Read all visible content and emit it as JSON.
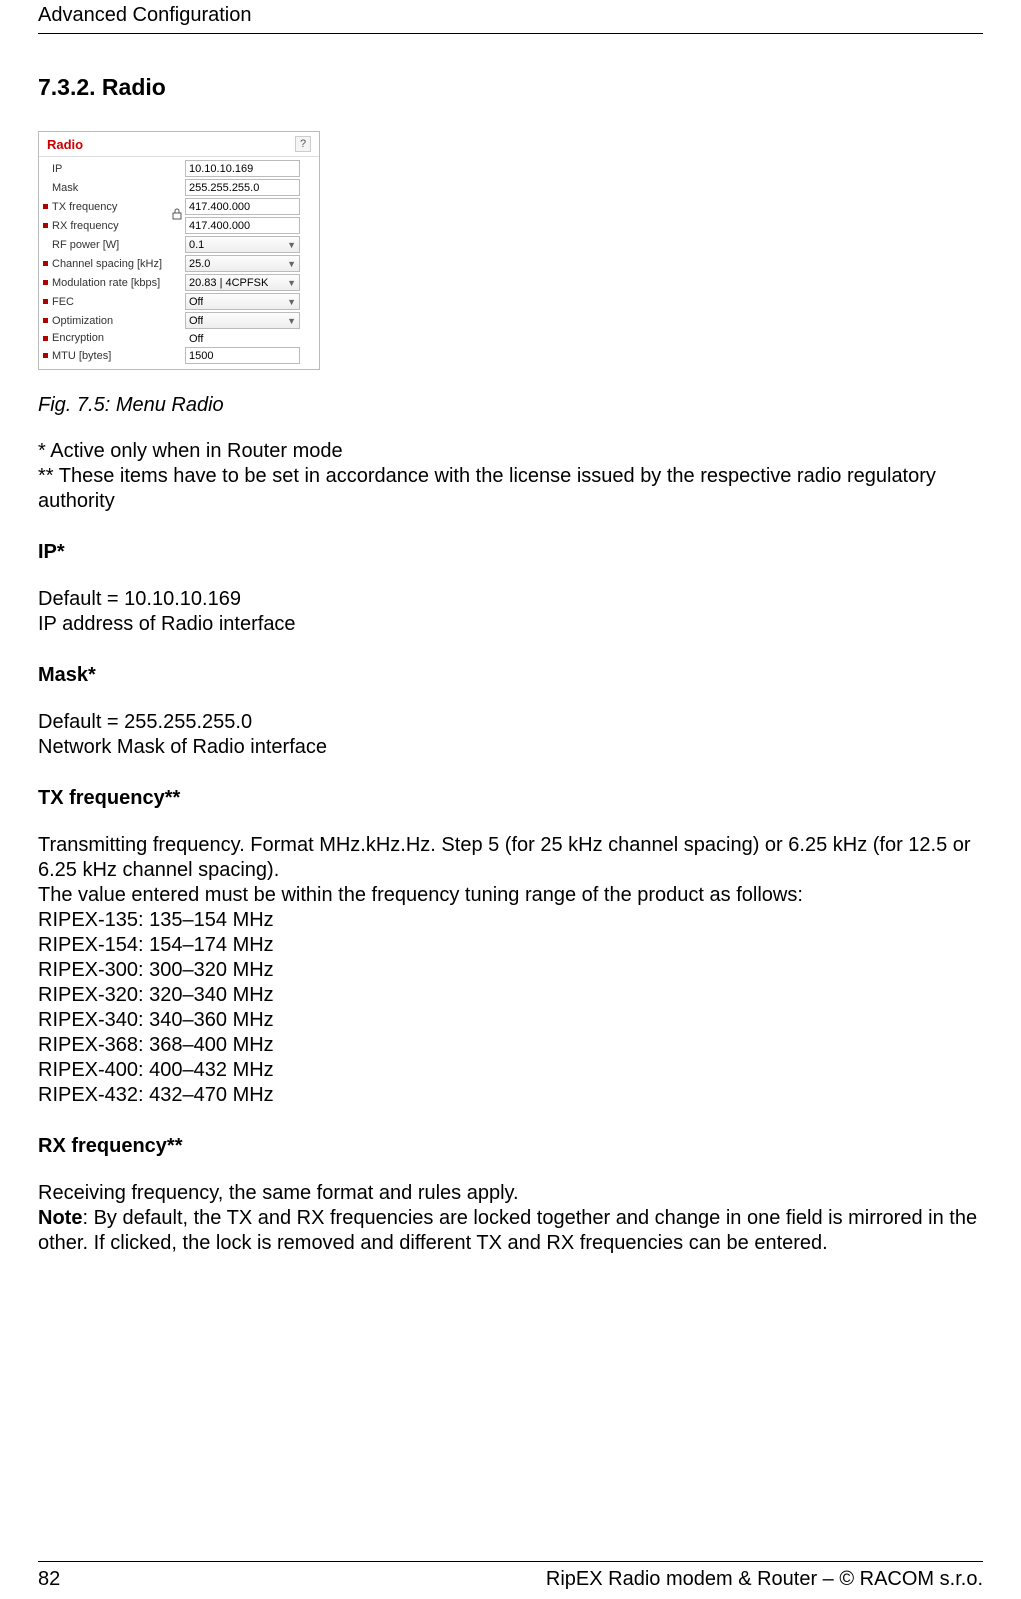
{
  "header": {
    "running": "Advanced Configuration"
  },
  "heading": "7.3.2. Radio",
  "panel": {
    "title": "Radio",
    "help": "?",
    "rows": [
      {
        "bullet": false,
        "label": "IP",
        "type": "text",
        "value": "10.10.10.169"
      },
      {
        "bullet": false,
        "label": "Mask",
        "type": "text",
        "value": "255.255.255.0"
      },
      {
        "bullet": true,
        "label": "TX frequency",
        "type": "text",
        "value": "417.400.000",
        "lock": true
      },
      {
        "bullet": true,
        "label": "RX frequency",
        "type": "text",
        "value": "417.400.000"
      },
      {
        "bullet": false,
        "label": "RF power [W]",
        "type": "select",
        "value": "0.1"
      },
      {
        "bullet": true,
        "label": "Channel spacing [kHz]",
        "type": "select",
        "value": "25.0"
      },
      {
        "bullet": true,
        "label": "Modulation rate [kbps]",
        "type": "select",
        "value": "20.83 | 4CPFSK"
      },
      {
        "bullet": true,
        "label": "FEC",
        "type": "select",
        "value": "Off"
      },
      {
        "bullet": true,
        "label": "Optimization",
        "type": "select",
        "value": "Off"
      },
      {
        "bullet": true,
        "label": "Encryption",
        "type": "text-ro",
        "value": "Off"
      },
      {
        "bullet": true,
        "label": "MTU [bytes]",
        "type": "text",
        "value": "1500"
      }
    ]
  },
  "caption": "Fig. 7.5: Menu Radio",
  "notes": {
    "star1": "* Active only when in Router mode",
    "star2": "** These items have to be set in accordance with the license issued by the respective radio regulatory authority"
  },
  "sections": {
    "ip": {
      "title": "IP*",
      "l1": "Default = 10.10.10.169",
      "l2": "IP address of Radio interface"
    },
    "mask": {
      "title": "Mask*",
      "l1": "Default = 255.255.255.0",
      "l2": "Network Mask of Radio interface"
    },
    "txf": {
      "title": "TX frequency**",
      "p1": "Transmitting frequency. Format MHz.kHz.Hz. Step 5 (for 25 kHz channel spacing) or 6.25 kHz (for 12.5 or 6.25 kHz channel spacing).",
      "p2": "The value entered must be within the frequency tuning range of the product as follows:",
      "r1": "RIPEX-135: 135–154 MHz",
      "r2": "RIPEX-154: 154–174 MHz",
      "r3": "RIPEX-300: 300–320 MHz",
      "r4": "RIPEX-320: 320–340 MHz",
      "r5": "RIPEX-340: 340–360 MHz",
      "r6": "RIPEX-368: 368–400 MHz",
      "r7": "RIPEX-400: 400–432 MHz",
      "r8": "RIPEX-432: 432–470 MHz"
    },
    "rxf": {
      "title": "RX frequency**",
      "p1": "Receiving frequency, the same format and rules apply.",
      "note_label": "Note",
      "note_body": ": By default, the TX and RX frequencies are locked together and change in one field is mirrored in the other. If clicked, the lock is removed and different TX and RX frequencies can be entered."
    }
  },
  "footer": {
    "page": "82",
    "right": "RipEX Radio modem & Router – © RACOM s.r.o."
  }
}
